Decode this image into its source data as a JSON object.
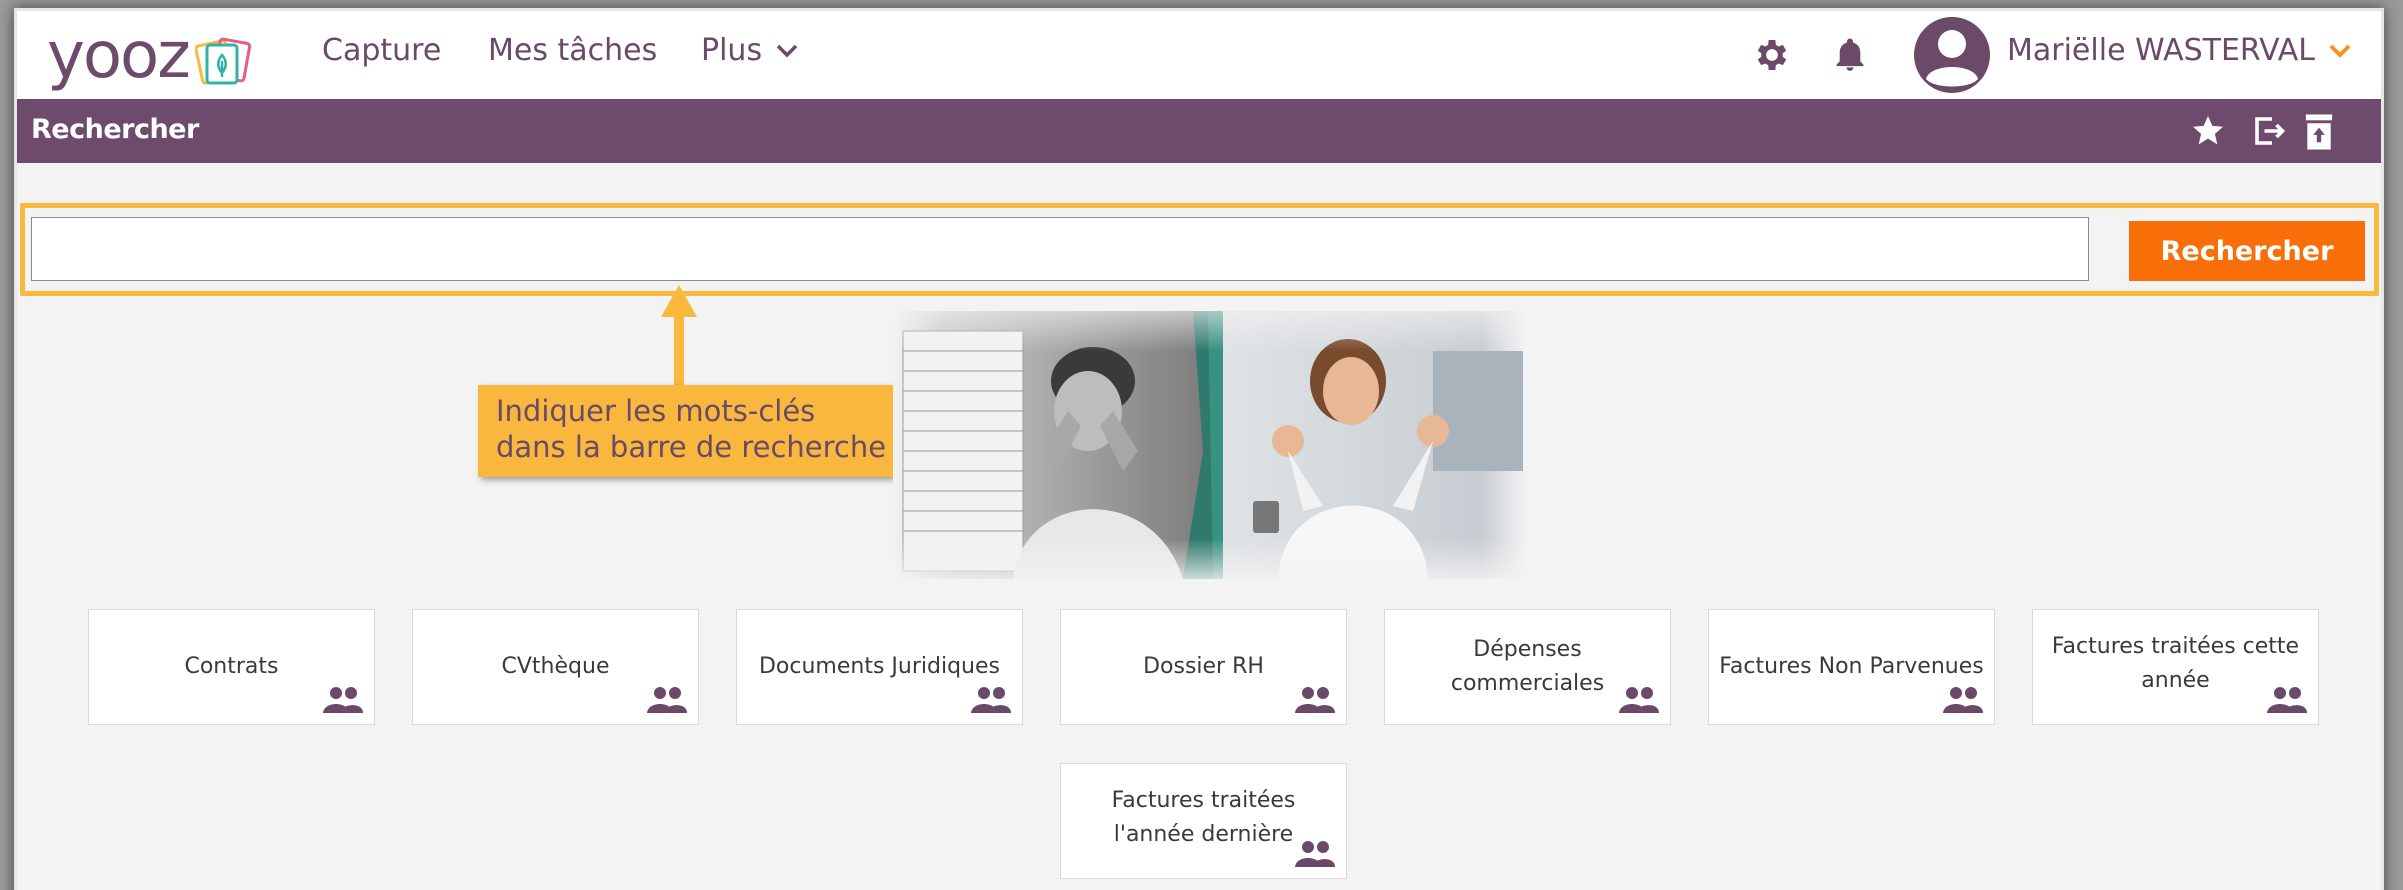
{
  "app": {
    "logo_text": "yooz",
    "brand_color": "#6e4b6c",
    "accent_color": "#f86f0a",
    "highlight_color": "#f8b93d"
  },
  "nav": {
    "items": [
      {
        "label": "Capture"
      },
      {
        "label": "Mes tâches"
      },
      {
        "label": "Plus"
      }
    ],
    "user_name": "Mariëlle WASTERVAL",
    "icons": [
      "gear-icon",
      "bell-icon",
      "user-avatar-icon",
      "chevron-down-icon"
    ]
  },
  "search_panel": {
    "title": "Rechercher",
    "header_icons": [
      "star-icon",
      "export-icon",
      "archive-icon"
    ],
    "input_value": "",
    "button_label": "Rechercher"
  },
  "annotation": {
    "line1": "Indiquer les mots-clés",
    "line2": "dans la barre de recherche"
  },
  "cards": [
    {
      "label": "Contrats",
      "icon": "shared-users-icon"
    },
    {
      "label": "CVthèque",
      "icon": "shared-users-icon"
    },
    {
      "label": "Documents Juridiques",
      "icon": "shared-users-icon"
    },
    {
      "label": "Dossier RH",
      "icon": "shared-users-icon"
    },
    {
      "label": "Dépenses commerciales",
      "icon": "shared-users-icon"
    },
    {
      "label": "Factures Non Parvenues",
      "icon": "shared-users-icon"
    },
    {
      "label": "Factures traitées cette année",
      "icon": "shared-users-icon"
    },
    {
      "label": "Factures traitées l'année dernière",
      "icon": "shared-users-icon"
    }
  ]
}
